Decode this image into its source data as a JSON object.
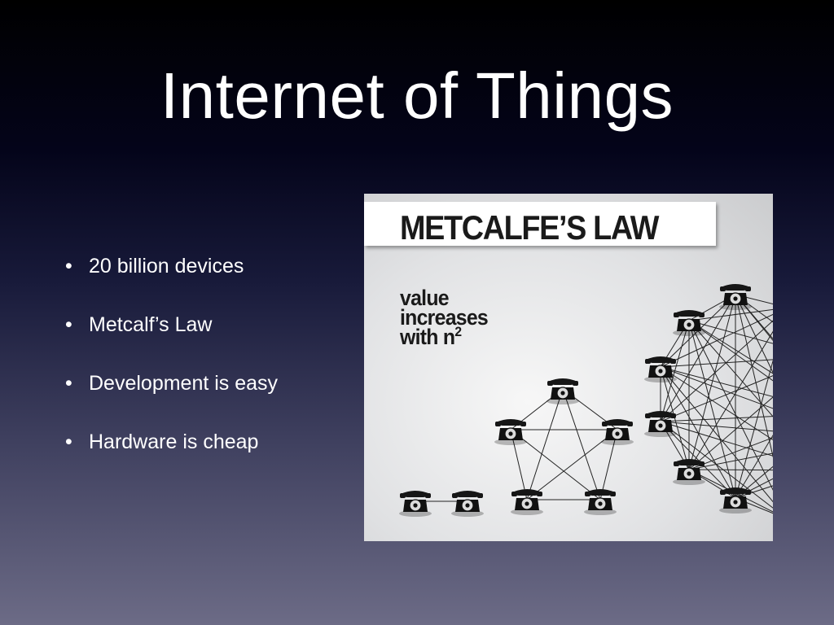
{
  "slide": {
    "title": "Internet of Things",
    "bullet_char": "•",
    "bullets": [
      "20 billion devices",
      "Metcalf’s Law",
      "Development is easy",
      "Hardware is cheap"
    ]
  },
  "figure": {
    "banner": "METCALFE’S LAW",
    "caption_line1": "value",
    "caption_line2": "increases",
    "caption_line3_prefix": "with n",
    "caption_superscript": "2",
    "icon": "rotary-telephone-icon",
    "groups": [
      {
        "name": "two-phone-network",
        "phones": 2
      },
      {
        "name": "five-phone-network",
        "phones": 5
      },
      {
        "name": "twelve-phone-network",
        "phones": 12
      }
    ]
  },
  "colors": {
    "background_top": "#000000",
    "background_bottom": "#6c6b86",
    "text": "#ffffff",
    "figure_text": "#1a1a1a",
    "network_line": "#222222"
  }
}
